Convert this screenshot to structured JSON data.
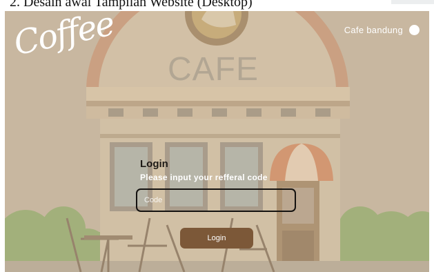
{
  "document": {
    "caption": "2. Desain awal Tampilan Website (Desktop)"
  },
  "brand": {
    "logo_text": "Coffee"
  },
  "scene": {
    "sign_text": "CAFE"
  },
  "header": {
    "location_label": "Cafe bandung"
  },
  "login": {
    "title": "Login",
    "subtitle": "Please input your refferal code",
    "code_placeholder": "Code",
    "code_value": "",
    "button_label": "Login"
  },
  "colors": {
    "background": "#c9b9a3",
    "button": "#7c5838",
    "input_border": "#141210",
    "text_light": "#ffffff"
  }
}
